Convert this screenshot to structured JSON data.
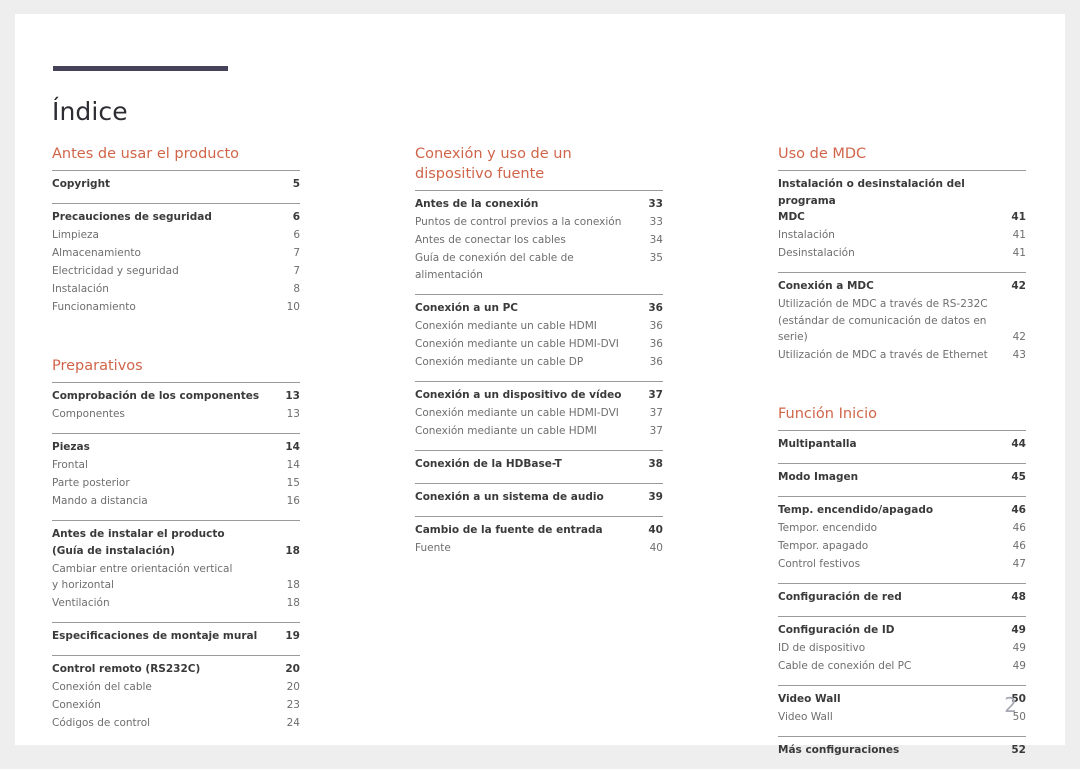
{
  "document": {
    "title": "Índice",
    "page_number": "2",
    "accent_color": "#d0654a",
    "rule_color": "#45425a",
    "page_number_color": "#a7a8b4"
  },
  "columns": [
    {
      "name": "column-left",
      "sections": [
        {
          "heading": "Antes de usar el producto",
          "groups": [
            {
              "entries": [
                {
                  "label": "Copyright",
                  "page": "5",
                  "level": "main"
                }
              ]
            },
            {
              "entries": [
                {
                  "label": "Precauciones de seguridad",
                  "page": "6",
                  "level": "main"
                },
                {
                  "label": "Limpieza",
                  "page": "6",
                  "level": "sub"
                },
                {
                  "label": "Almacenamiento",
                  "page": "7",
                  "level": "sub"
                },
                {
                  "label": "Electricidad y seguridad",
                  "page": "7",
                  "level": "sub"
                },
                {
                  "label": "Instalación",
                  "page": "8",
                  "level": "sub"
                },
                {
                  "label": "Funcionamiento",
                  "page": "10",
                  "level": "sub"
                }
              ]
            }
          ]
        },
        {
          "heading": "Preparativos",
          "groups": [
            {
              "entries": [
                {
                  "label": "Comprobación de los componentes",
                  "page": "13",
                  "level": "main"
                },
                {
                  "label": "Componentes",
                  "page": "13",
                  "level": "sub"
                }
              ]
            },
            {
              "entries": [
                {
                  "label": "Piezas",
                  "page": "14",
                  "level": "main"
                },
                {
                  "label": "Frontal",
                  "page": "14",
                  "level": "sub"
                },
                {
                  "label": "Parte posterior",
                  "page": "15",
                  "level": "sub"
                },
                {
                  "label": "Mando a distancia",
                  "page": "16",
                  "level": "sub"
                }
              ]
            },
            {
              "entries": [
                {
                  "label": "Antes de instalar el producto\n(Guía de instalación)",
                  "page": "18",
                  "level": "main",
                  "multiline": true
                },
                {
                  "label": "Cambiar entre orientación vertical\ny horizontal",
                  "page": "18",
                  "level": "sub",
                  "multiline": true
                },
                {
                  "label": "Ventilación",
                  "page": "18",
                  "level": "sub"
                }
              ]
            },
            {
              "entries": [
                {
                  "label": "Especificaciones de montaje mural",
                  "page": "19",
                  "level": "main"
                }
              ]
            },
            {
              "entries": [
                {
                  "label": "Control remoto (RS232C)",
                  "page": "20",
                  "level": "main"
                },
                {
                  "label": "Conexión del cable",
                  "page": "20",
                  "level": "sub"
                },
                {
                  "label": "Conexión",
                  "page": "23",
                  "level": "sub"
                },
                {
                  "label": "Códigos de control",
                  "page": "24",
                  "level": "sub"
                }
              ]
            }
          ]
        }
      ]
    },
    {
      "name": "column-middle",
      "sections": [
        {
          "heading": "Conexión y uso de un\ndispositivo fuente",
          "groups": [
            {
              "entries": [
                {
                  "label": "Antes de la conexión",
                  "page": "33",
                  "level": "main"
                },
                {
                  "label": "Puntos de control previos a la conexión",
                  "page": "33",
                  "level": "sub"
                },
                {
                  "label": "Antes de conectar los cables",
                  "page": "34",
                  "level": "sub"
                },
                {
                  "label": "Guía de conexión del cable de alimentación",
                  "page": "35",
                  "level": "sub",
                  "hug": true
                }
              ]
            },
            {
              "entries": [
                {
                  "label": "Conexión a un PC",
                  "page": "36",
                  "level": "main"
                },
                {
                  "label": "Conexión mediante un cable HDMI",
                  "page": "36",
                  "level": "sub"
                },
                {
                  "label": "Conexión mediante un cable HDMI-DVI",
                  "page": "36",
                  "level": "sub"
                },
                {
                  "label": "Conexión mediante un cable DP",
                  "page": "36",
                  "level": "sub"
                }
              ]
            },
            {
              "entries": [
                {
                  "label": "Conexión a un dispositivo de vídeo",
                  "page": "37",
                  "level": "main"
                },
                {
                  "label": "Conexión mediante un cable HDMI-DVI",
                  "page": "37",
                  "level": "sub"
                },
                {
                  "label": "Conexión mediante un cable HDMI",
                  "page": "37",
                  "level": "sub"
                }
              ]
            },
            {
              "entries": [
                {
                  "label": "Conexión de la HDBase-T",
                  "page": "38",
                  "level": "main"
                }
              ]
            },
            {
              "entries": [
                {
                  "label": "Conexión a un sistema de audio",
                  "page": "39",
                  "level": "main"
                }
              ]
            },
            {
              "entries": [
                {
                  "label": "Cambio de la fuente de entrada",
                  "page": "40",
                  "level": "main"
                },
                {
                  "label": "Fuente",
                  "page": "40",
                  "level": "sub"
                }
              ]
            }
          ]
        }
      ]
    },
    {
      "name": "column-right",
      "sections": [
        {
          "heading": "Uso de MDC",
          "groups": [
            {
              "entries": [
                {
                  "label": "Instalación o desinstalación del programa\nMDC",
                  "page": "41",
                  "level": "main",
                  "multiline": true
                },
                {
                  "label": "Instalación",
                  "page": "41",
                  "level": "sub"
                },
                {
                  "label": "Desinstalación",
                  "page": "41",
                  "level": "sub"
                }
              ]
            },
            {
              "entries": [
                {
                  "label": "Conexión a MDC",
                  "page": "42",
                  "level": "main"
                },
                {
                  "label": "Utilización de MDC a través de RS-232C\n(estándar de comunicación de datos en serie)",
                  "page": "42",
                  "level": "sub",
                  "multiline": true,
                  "hug": true
                },
                {
                  "label": "Utilización de MDC a través de Ethernet",
                  "page": "43",
                  "level": "sub"
                }
              ]
            }
          ]
        },
        {
          "heading": "Función Inicio",
          "groups": [
            {
              "entries": [
                {
                  "label": "Multipantalla",
                  "page": "44",
                  "level": "main"
                }
              ]
            },
            {
              "entries": [
                {
                  "label": "Modo Imagen",
                  "page": "45",
                  "level": "main"
                }
              ]
            },
            {
              "entries": [
                {
                  "label": "Temp. encendido/apagado",
                  "page": "46",
                  "level": "main"
                },
                {
                  "label": "Tempor. encendido",
                  "page": "46",
                  "level": "sub"
                },
                {
                  "label": "Tempor. apagado",
                  "page": "46",
                  "level": "sub"
                },
                {
                  "label": "Control festivos",
                  "page": "47",
                  "level": "sub"
                }
              ]
            },
            {
              "entries": [
                {
                  "label": "Configuración de red",
                  "page": "48",
                  "level": "main"
                }
              ]
            },
            {
              "entries": [
                {
                  "label": "Configuración de ID",
                  "page": "49",
                  "level": "main"
                },
                {
                  "label": "ID de dispositivo",
                  "page": "49",
                  "level": "sub"
                },
                {
                  "label": "Cable de conexión del PC",
                  "page": "49",
                  "level": "sub"
                }
              ]
            },
            {
              "entries": [
                {
                  "label": "Video Wall",
                  "page": "50",
                  "level": "main"
                },
                {
                  "label": "Video Wall",
                  "page": "50",
                  "level": "sub"
                }
              ]
            },
            {
              "entries": [
                {
                  "label": "Más configuraciones",
                  "page": "52",
                  "level": "main"
                }
              ]
            }
          ]
        }
      ]
    }
  ]
}
